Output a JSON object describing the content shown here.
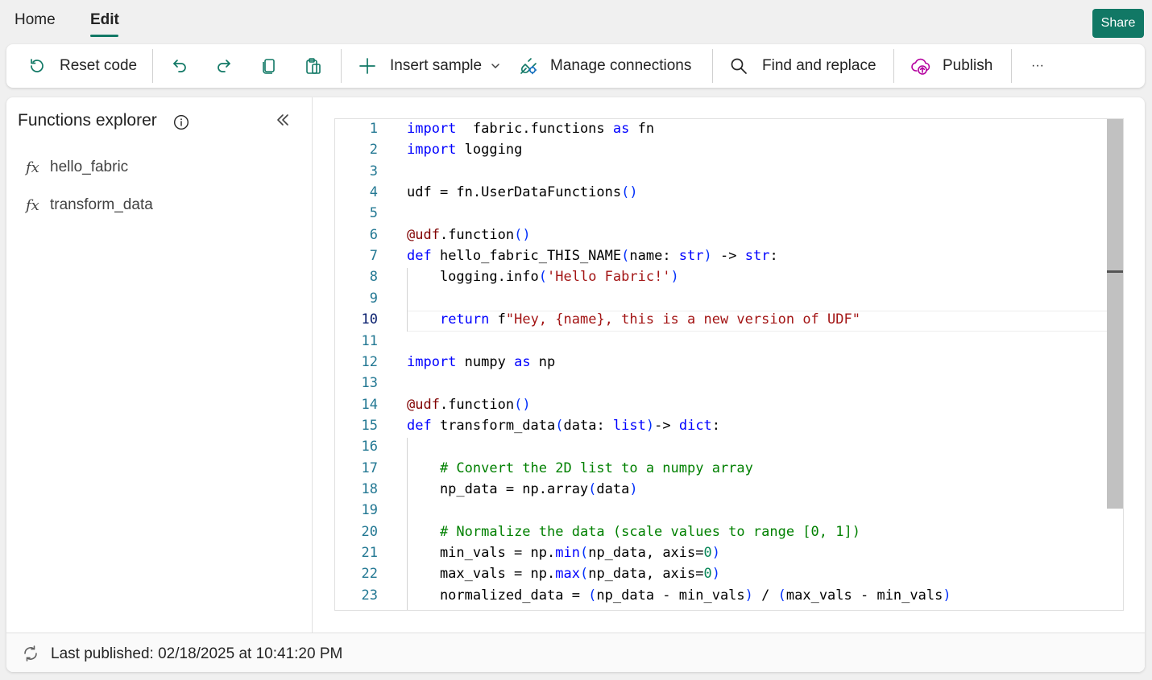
{
  "tabs": {
    "home": "Home",
    "edit": "Edit"
  },
  "share_label": "Share",
  "toolbar": {
    "reset_code": "Reset code",
    "insert_sample": "Insert sample",
    "manage_connections": "Manage connections",
    "find_replace": "Find and replace",
    "publish": "Publish",
    "more": "···"
  },
  "explorer": {
    "title": "Functions explorer",
    "functions": [
      "hello_fabric",
      "transform_data"
    ]
  },
  "editor": {
    "active_line": 10,
    "lines": [
      [
        [
          "kw",
          "import"
        ],
        [
          "",
          "  fabric.functions "
        ],
        [
          "kw",
          "as"
        ],
        [
          "",
          " fn"
        ]
      ],
      [
        [
          "kw",
          "import"
        ],
        [
          "",
          " logging"
        ]
      ],
      [],
      [
        [
          "",
          "udf = fn.UserDataFunctions"
        ],
        [
          "br",
          "()"
        ]
      ],
      [],
      [
        [
          "dec2",
          "@udf"
        ],
        [
          "",
          ".function"
        ],
        [
          "br",
          "()"
        ]
      ],
      [
        [
          "kw",
          "def"
        ],
        [
          "",
          " hello_fabric_THIS_NAME"
        ],
        [
          "br",
          "("
        ],
        [
          "",
          "name: "
        ],
        [
          "kw",
          "str"
        ],
        [
          "br",
          ")"
        ],
        [
          "",
          " -> "
        ],
        [
          "kw",
          "str"
        ],
        [
          "",
          ":"
        ]
      ],
      [
        [
          "",
          "    logging.info"
        ],
        [
          "br",
          "("
        ],
        [
          "str",
          "'Hello Fabric!'"
        ],
        [
          "br",
          ")"
        ]
      ],
      [],
      [
        [
          "",
          "    "
        ],
        [
          "kw",
          "return"
        ],
        [
          "",
          " f"
        ],
        [
          "str",
          "\"Hey, {name}, this is a new version of UDF\""
        ]
      ],
      [],
      [
        [
          "kw",
          "import"
        ],
        [
          "",
          " numpy "
        ],
        [
          "kw",
          "as"
        ],
        [
          "",
          " np"
        ]
      ],
      [],
      [
        [
          "dec2",
          "@udf"
        ],
        [
          "",
          ".function"
        ],
        [
          "br",
          "()"
        ]
      ],
      [
        [
          "kw",
          "def"
        ],
        [
          "",
          " transform_data"
        ],
        [
          "br",
          "("
        ],
        [
          "",
          "data: "
        ],
        [
          "kw",
          "list"
        ],
        [
          "br",
          ")"
        ],
        [
          "",
          "-> "
        ],
        [
          "kw",
          "dict"
        ],
        [
          "",
          ":"
        ]
      ],
      [],
      [
        [
          "",
          "    "
        ],
        [
          "cmt",
          "# Convert the 2D list to a numpy array"
        ]
      ],
      [
        [
          "",
          "    np_data = np.array"
        ],
        [
          "br",
          "("
        ],
        [
          "",
          "data"
        ],
        [
          "br",
          ")"
        ]
      ],
      [],
      [
        [
          "",
          "    "
        ],
        [
          "cmt",
          "# Normalize the data (scale values to range [0, 1])"
        ]
      ],
      [
        [
          "",
          "    min_vals = np."
        ],
        [
          "kw",
          "min"
        ],
        [
          "br",
          "("
        ],
        [
          "",
          "np_data, axis="
        ],
        [
          "num",
          "0"
        ],
        [
          "br",
          ")"
        ]
      ],
      [
        [
          "",
          "    max_vals = np."
        ],
        [
          "kw",
          "max"
        ],
        [
          "br",
          "("
        ],
        [
          "",
          "np_data, axis="
        ],
        [
          "num",
          "0"
        ],
        [
          "br",
          ")"
        ]
      ],
      [
        [
          "",
          "    normalized_data = "
        ],
        [
          "br",
          "("
        ],
        [
          "",
          "np_data - min_vals"
        ],
        [
          "br",
          ")"
        ],
        [
          "",
          " / "
        ],
        [
          "br",
          "("
        ],
        [
          "",
          "max_vals - min_vals"
        ],
        [
          "br",
          ")"
        ]
      ]
    ]
  },
  "status": {
    "last_published": "Last published: 02/18/2025 at 10:41:20 PM"
  },
  "colors": {
    "accent": "#117865",
    "keyword": "#0000ff",
    "string": "#a31515",
    "comment": "#008000",
    "line_number": "#237893"
  }
}
